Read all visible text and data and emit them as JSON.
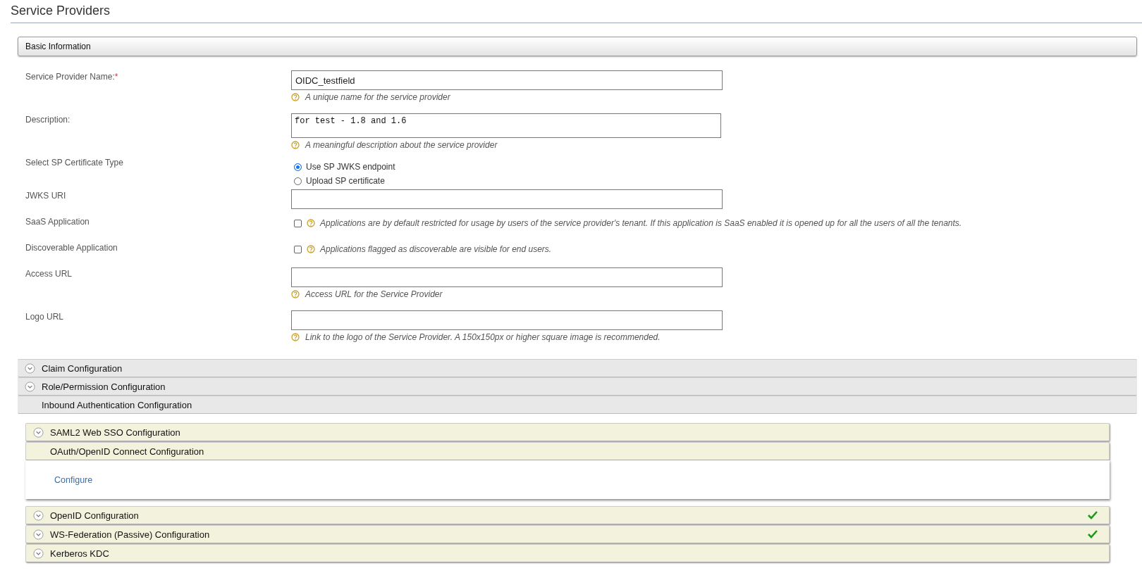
{
  "page_title": "Service Providers",
  "basic_information": {
    "title": "Basic Information",
    "fields": [
      {
        "kind": "text",
        "label": "Service Provider Name:",
        "required_mark": "*",
        "value": "OIDC_testfield",
        "hint": "A unique name for the service provider"
      },
      {
        "kind": "textarea",
        "label": "Description:",
        "value": "for test - 1.8 and 1.6",
        "hint": "A meaningful description about the service provider"
      },
      {
        "kind": "radio",
        "label": "Select SP Certificate Type",
        "options": [
          {
            "label": "Use SP JWKS endpoint",
            "selected": true
          },
          {
            "label": "Upload SP certificate",
            "selected": false
          }
        ]
      },
      {
        "kind": "text",
        "label": "JWKS URI"
      },
      {
        "kind": "checkbox",
        "label": "SaaS Application",
        "checked": false,
        "hint": "Applications are by default restricted for usage by users of the service provider's tenant. If this application is SaaS enabled it is opened up for all the users of all the tenants."
      },
      {
        "kind": "checkbox",
        "label": "Discoverable Application",
        "checked": false,
        "hint": "Applications flagged as discoverable are visible for end users."
      },
      {
        "kind": "text",
        "label": "Access URL",
        "hint": "Access URL for the Service Provider"
      },
      {
        "kind": "text",
        "label": "Logo URL",
        "hint": "Link to the logo of the Service Provider. A 150x150px or higher square image is recommended."
      }
    ]
  },
  "sections": [
    {
      "title": "Claim Configuration",
      "expanded": false
    },
    {
      "title": "Role/Permission Configuration",
      "expanded": false
    },
    {
      "title": "Inbound Authentication Configuration",
      "expanded": true,
      "children": [
        {
          "title": "SAML2 Web SSO Configuration",
          "expanded": false,
          "configured": false
        },
        {
          "title": "OAuth/OpenID Connect Configuration",
          "expanded": true,
          "configured": false,
          "link": "Configure"
        },
        {
          "title": "OpenID Configuration",
          "expanded": false,
          "configured": true
        },
        {
          "title": "WS-Federation (Passive) Configuration",
          "expanded": false,
          "configured": true
        },
        {
          "title": "Kerberos KDC",
          "expanded": false,
          "configured": false
        }
      ]
    }
  ]
}
